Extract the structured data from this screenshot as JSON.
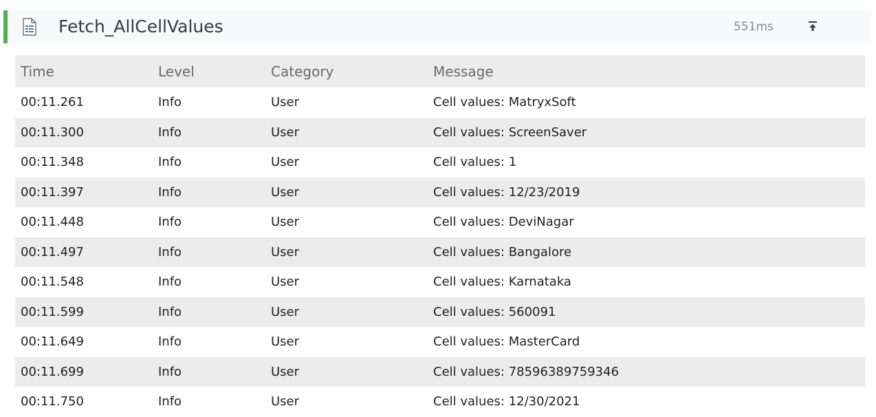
{
  "header": {
    "title": "Fetch_AllCellValues",
    "duration": "551ms",
    "accent_color": "#4caf50",
    "icon": "document-icon",
    "collapse_icon": "collapse-to-top-icon"
  },
  "table": {
    "columns": [
      "Time",
      "Level",
      "Category",
      "Message"
    ],
    "rows": [
      [
        "00:11.261",
        "Info",
        "User",
        "Cell values: MatryxSoft"
      ],
      [
        "00:11.300",
        "Info",
        "User",
        "Cell values: ScreenSaver"
      ],
      [
        "00:11.348",
        "Info",
        "User",
        "Cell values: 1"
      ],
      [
        "00:11.397",
        "Info",
        "User",
        "Cell values: 12/23/2019"
      ],
      [
        "00:11.448",
        "Info",
        "User",
        "Cell values: DeviNagar"
      ],
      [
        "00:11.497",
        "Info",
        "User",
        "Cell values: Bangalore"
      ],
      [
        "00:11.548",
        "Info",
        "User",
        "Cell values: Karnataka"
      ],
      [
        "00:11.599",
        "Info",
        "User",
        "Cell values: 560091"
      ],
      [
        "00:11.649",
        "Info",
        "User",
        "Cell values: MasterCard"
      ],
      [
        "00:11.699",
        "Info",
        "User",
        "Cell values: 78596389759346"
      ],
      [
        "00:11.750",
        "Info",
        "User",
        "Cell values: 12/30/2021"
      ]
    ]
  }
}
